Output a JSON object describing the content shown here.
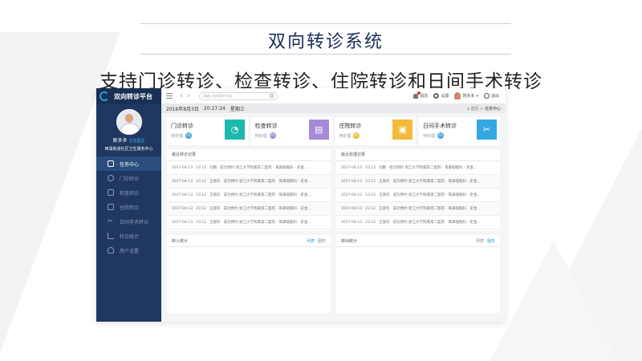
{
  "slide": {
    "title": "双向转诊系统",
    "subtitle": "支持门诊转诊、检查转诊、住院转诊和日间手术转诊"
  },
  "app": {
    "platform_name": "双向转诊平台",
    "user": {
      "name": "刚多多",
      "role": "主治医生",
      "org": "西溪街道社区卫生服务中心"
    },
    "nav": [
      {
        "label": "任务中心",
        "icon": "dashboard-icon",
        "active": true
      },
      {
        "label": "门诊转诊",
        "icon": "clock-icon",
        "active": false
      },
      {
        "label": "检查转诊",
        "icon": "document-icon",
        "active": false
      },
      {
        "label": "住院转诊",
        "icon": "clipboard-icon",
        "active": false
      },
      {
        "label": "日间手术转诊",
        "icon": "scissors-icon",
        "active": false
      },
      {
        "label": "转诊统计",
        "icon": "chart-icon",
        "active": false
      },
      {
        "label": "用户设置",
        "icon": "user-icon",
        "active": false
      }
    ],
    "topbar": {
      "search_placeholder": "请输入查询条件内容",
      "messages": "消息",
      "settings": "设置",
      "username": "刚多多",
      "logout": "退出"
    },
    "infobar": {
      "date": "2016年8月3日",
      "time": "20:27:24",
      "weekday": "星期三",
      "breadcrumb_home": "首页",
      "breadcrumb_current": "任务中心"
    },
    "cards": [
      {
        "title": "门诊转诊",
        "pending_label": "待处理",
        "count": "01",
        "icon": "clock-icon",
        "color": "#1fb8b0",
        "glyph": "◔"
      },
      {
        "title": "检查转诊",
        "pending_label": "待处理",
        "count": "01",
        "icon": "document-icon",
        "color": "#a58ad6",
        "glyph": "▤"
      },
      {
        "title": "住院转诊",
        "pending_label": "待处理",
        "count": "01",
        "icon": "clipboard-icon",
        "color": "#f3b93a",
        "glyph": "▣"
      },
      {
        "title": "日间手术转诊",
        "pending_label": "待处理",
        "count": "01",
        "icon": "scissors-icon",
        "color": "#35a7e4",
        "glyph": "✂"
      }
    ],
    "recent_referrals": {
      "title": "最近转诊记录",
      "rows": [
        {
          "date": "2017-04-13",
          "time": "23:12",
          "name": "刘鹏",
          "text": "成功预约 浙江大学附属第二医院 - 耳鼻咽喉科 - 史金..."
        },
        {
          "date": "2017-04-13",
          "time": "23:12",
          "name": "王朋华",
          "text": "成功预约 浙江大学附属第二医院 - 耳鼻咽喉科 - 史金..."
        },
        {
          "date": "2017-04-13",
          "time": "23:12",
          "name": "王朋华",
          "text": "成功预约 浙江大学附属第二医院 - 耳鼻咽喉科 - 史金..."
        },
        {
          "date": "2017-04-13",
          "time": "23:12",
          "name": "王朋华",
          "text": "成功预约 浙江大学附属第二医院 - 耳鼻咽喉科 - 史金..."
        },
        {
          "date": "2017-04-13",
          "time": "23:12",
          "name": "王朋华",
          "text": "成功预约 浙江大学附属第二医院 - 耳鼻咽喉科 - 史金..."
        }
      ]
    },
    "recent_processed": {
      "title": "最近处理记录",
      "rows": [
        {
          "date": "2017-04-13",
          "time": "23:12",
          "name": "刘鹏",
          "text": "成功预约 浙江大学附属第二医院 - 耳鼻咽喉科 - 史金..."
        },
        {
          "date": "2017-04-13",
          "time": "23:12",
          "name": "王朋华",
          "text": "成功预约 浙江大学附属第二医院 - 耳鼻咽喉科 - 史金..."
        },
        {
          "date": "2017-04-13",
          "time": "23:12",
          "name": "王朋华",
          "text": "成功预约 浙江大学附属第二医院 - 耳鼻咽喉科 - 史金..."
        },
        {
          "date": "2017-04-13",
          "time": "23:12",
          "name": "王朋华",
          "text": "成功预约 浙江大学附属第二医院 - 耳鼻咽喉科 - 史金..."
        },
        {
          "date": "2017-04-13",
          "time": "23:12",
          "name": "王朋华",
          "text": "成功预约 浙江大学附属第二医院 - 耳鼻咽喉科 - 史金..."
        }
      ]
    },
    "stats": [
      {
        "title": "转入统计",
        "tab_list": "列表",
        "tab_chart": "图形"
      },
      {
        "title": "转出统计",
        "tab_list": "列表",
        "tab_chart": "图形"
      }
    ]
  }
}
